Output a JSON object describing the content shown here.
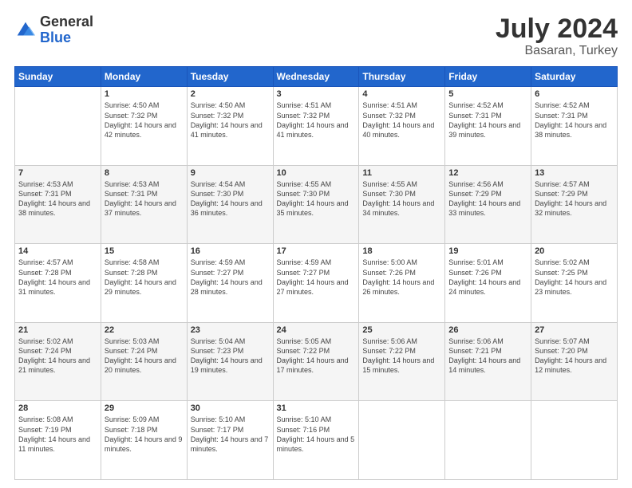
{
  "header": {
    "logo_general": "General",
    "logo_blue": "Blue",
    "month_year": "July 2024",
    "location": "Basaran, Turkey"
  },
  "days_of_week": [
    "Sunday",
    "Monday",
    "Tuesday",
    "Wednesday",
    "Thursday",
    "Friday",
    "Saturday"
  ],
  "weeks": [
    [
      {
        "day": "",
        "sunrise": "",
        "sunset": "",
        "daylight": ""
      },
      {
        "day": "1",
        "sunrise": "Sunrise: 4:50 AM",
        "sunset": "Sunset: 7:32 PM",
        "daylight": "Daylight: 14 hours and 42 minutes."
      },
      {
        "day": "2",
        "sunrise": "Sunrise: 4:50 AM",
        "sunset": "Sunset: 7:32 PM",
        "daylight": "Daylight: 14 hours and 41 minutes."
      },
      {
        "day": "3",
        "sunrise": "Sunrise: 4:51 AM",
        "sunset": "Sunset: 7:32 PM",
        "daylight": "Daylight: 14 hours and 41 minutes."
      },
      {
        "day": "4",
        "sunrise": "Sunrise: 4:51 AM",
        "sunset": "Sunset: 7:32 PM",
        "daylight": "Daylight: 14 hours and 40 minutes."
      },
      {
        "day": "5",
        "sunrise": "Sunrise: 4:52 AM",
        "sunset": "Sunset: 7:31 PM",
        "daylight": "Daylight: 14 hours and 39 minutes."
      },
      {
        "day": "6",
        "sunrise": "Sunrise: 4:52 AM",
        "sunset": "Sunset: 7:31 PM",
        "daylight": "Daylight: 14 hours and 38 minutes."
      }
    ],
    [
      {
        "day": "7",
        "sunrise": "Sunrise: 4:53 AM",
        "sunset": "Sunset: 7:31 PM",
        "daylight": "Daylight: 14 hours and 38 minutes."
      },
      {
        "day": "8",
        "sunrise": "Sunrise: 4:53 AM",
        "sunset": "Sunset: 7:31 PM",
        "daylight": "Daylight: 14 hours and 37 minutes."
      },
      {
        "day": "9",
        "sunrise": "Sunrise: 4:54 AM",
        "sunset": "Sunset: 7:30 PM",
        "daylight": "Daylight: 14 hours and 36 minutes."
      },
      {
        "day": "10",
        "sunrise": "Sunrise: 4:55 AM",
        "sunset": "Sunset: 7:30 PM",
        "daylight": "Daylight: 14 hours and 35 minutes."
      },
      {
        "day": "11",
        "sunrise": "Sunrise: 4:55 AM",
        "sunset": "Sunset: 7:30 PM",
        "daylight": "Daylight: 14 hours and 34 minutes."
      },
      {
        "day": "12",
        "sunrise": "Sunrise: 4:56 AM",
        "sunset": "Sunset: 7:29 PM",
        "daylight": "Daylight: 14 hours and 33 minutes."
      },
      {
        "day": "13",
        "sunrise": "Sunrise: 4:57 AM",
        "sunset": "Sunset: 7:29 PM",
        "daylight": "Daylight: 14 hours and 32 minutes."
      }
    ],
    [
      {
        "day": "14",
        "sunrise": "Sunrise: 4:57 AM",
        "sunset": "Sunset: 7:28 PM",
        "daylight": "Daylight: 14 hours and 31 minutes."
      },
      {
        "day": "15",
        "sunrise": "Sunrise: 4:58 AM",
        "sunset": "Sunset: 7:28 PM",
        "daylight": "Daylight: 14 hours and 29 minutes."
      },
      {
        "day": "16",
        "sunrise": "Sunrise: 4:59 AM",
        "sunset": "Sunset: 7:27 PM",
        "daylight": "Daylight: 14 hours and 28 minutes."
      },
      {
        "day": "17",
        "sunrise": "Sunrise: 4:59 AM",
        "sunset": "Sunset: 7:27 PM",
        "daylight": "Daylight: 14 hours and 27 minutes."
      },
      {
        "day": "18",
        "sunrise": "Sunrise: 5:00 AM",
        "sunset": "Sunset: 7:26 PM",
        "daylight": "Daylight: 14 hours and 26 minutes."
      },
      {
        "day": "19",
        "sunrise": "Sunrise: 5:01 AM",
        "sunset": "Sunset: 7:26 PM",
        "daylight": "Daylight: 14 hours and 24 minutes."
      },
      {
        "day": "20",
        "sunrise": "Sunrise: 5:02 AM",
        "sunset": "Sunset: 7:25 PM",
        "daylight": "Daylight: 14 hours and 23 minutes."
      }
    ],
    [
      {
        "day": "21",
        "sunrise": "Sunrise: 5:02 AM",
        "sunset": "Sunset: 7:24 PM",
        "daylight": "Daylight: 14 hours and 21 minutes."
      },
      {
        "day": "22",
        "sunrise": "Sunrise: 5:03 AM",
        "sunset": "Sunset: 7:24 PM",
        "daylight": "Daylight: 14 hours and 20 minutes."
      },
      {
        "day": "23",
        "sunrise": "Sunrise: 5:04 AM",
        "sunset": "Sunset: 7:23 PM",
        "daylight": "Daylight: 14 hours and 19 minutes."
      },
      {
        "day": "24",
        "sunrise": "Sunrise: 5:05 AM",
        "sunset": "Sunset: 7:22 PM",
        "daylight": "Daylight: 14 hours and 17 minutes."
      },
      {
        "day": "25",
        "sunrise": "Sunrise: 5:06 AM",
        "sunset": "Sunset: 7:22 PM",
        "daylight": "Daylight: 14 hours and 15 minutes."
      },
      {
        "day": "26",
        "sunrise": "Sunrise: 5:06 AM",
        "sunset": "Sunset: 7:21 PM",
        "daylight": "Daylight: 14 hours and 14 minutes."
      },
      {
        "day": "27",
        "sunrise": "Sunrise: 5:07 AM",
        "sunset": "Sunset: 7:20 PM",
        "daylight": "Daylight: 14 hours and 12 minutes."
      }
    ],
    [
      {
        "day": "28",
        "sunrise": "Sunrise: 5:08 AM",
        "sunset": "Sunset: 7:19 PM",
        "daylight": "Daylight: 14 hours and 11 minutes."
      },
      {
        "day": "29",
        "sunrise": "Sunrise: 5:09 AM",
        "sunset": "Sunset: 7:18 PM",
        "daylight": "Daylight: 14 hours and 9 minutes."
      },
      {
        "day": "30",
        "sunrise": "Sunrise: 5:10 AM",
        "sunset": "Sunset: 7:17 PM",
        "daylight": "Daylight: 14 hours and 7 minutes."
      },
      {
        "day": "31",
        "sunrise": "Sunrise: 5:10 AM",
        "sunset": "Sunset: 7:16 PM",
        "daylight": "Daylight: 14 hours and 5 minutes."
      },
      {
        "day": "",
        "sunrise": "",
        "sunset": "",
        "daylight": ""
      },
      {
        "day": "",
        "sunrise": "",
        "sunset": "",
        "daylight": ""
      },
      {
        "day": "",
        "sunrise": "",
        "sunset": "",
        "daylight": ""
      }
    ]
  ]
}
